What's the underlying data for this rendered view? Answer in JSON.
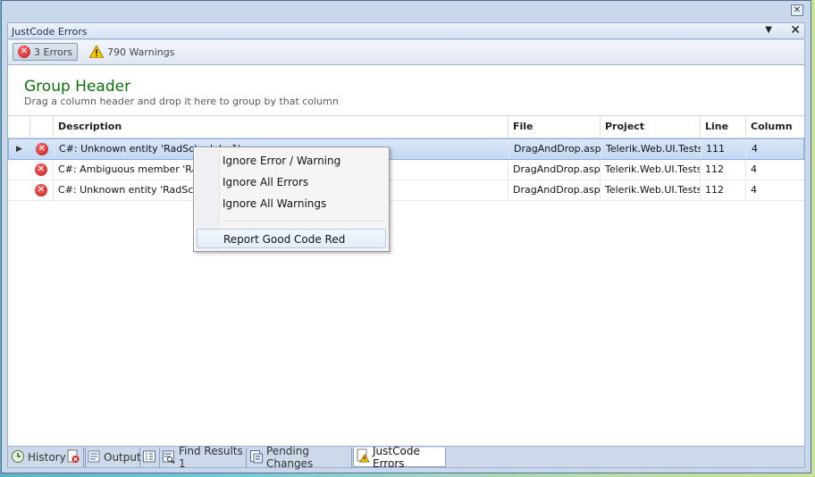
{
  "window": {
    "close_glyph": "✕"
  },
  "panel": {
    "title": "JustCode Errors",
    "dropdown_glyph": "▼",
    "close_glyph": "✕"
  },
  "toolbar": {
    "errors_label": "3 Errors",
    "warnings_label": "790 Warnings"
  },
  "group_header": {
    "title": "Group Header",
    "subtitle": "Drag a column header and drop it here to group by that column"
  },
  "grid": {
    "columns": [
      "Description",
      "File",
      "Project",
      "Line",
      "Column"
    ],
    "rows": [
      {
        "description": "C#: Unknown entity 'RadScheduler1'",
        "file": "DragAndDrop.aspx",
        "project": "Telerik.Web.UI.Tests",
        "line": "111",
        "column": "4"
      },
      {
        "description": "C#: Ambiguous member 'RadS",
        "file": "DragAndDrop.aspx",
        "project": "Telerik.Web.UI.Tests",
        "line": "112",
        "column": "4"
      },
      {
        "description": "C#: Unknown entity 'RadSched",
        "file": "DragAndDrop.aspx",
        "project": "Telerik.Web.UI.Tests",
        "line": "112",
        "column": "4"
      }
    ],
    "row_indicator": "▶"
  },
  "context_menu": {
    "items": [
      "Ignore Error / Warning",
      "Ignore All Errors",
      "Ignore All Warnings"
    ],
    "report_item": "Report Good Code Red"
  },
  "tabs": [
    {
      "label": "History",
      "icon": "history-icon"
    },
    {
      "label": "",
      "icon": "delete-error-icon"
    },
    {
      "label": "Output",
      "icon": "output-icon"
    },
    {
      "label": "",
      "icon": "list-icon"
    },
    {
      "label": "Find Results 1",
      "icon": "find-results-icon"
    },
    {
      "label": "Pending Changes",
      "icon": "pending-changes-icon"
    },
    {
      "label": "JustCode Errors",
      "icon": "justcode-errors-icon"
    }
  ],
  "colors": {
    "group_header_title": "#106c10",
    "error_red": "#c01818",
    "selection": "#c3d8f2"
  }
}
